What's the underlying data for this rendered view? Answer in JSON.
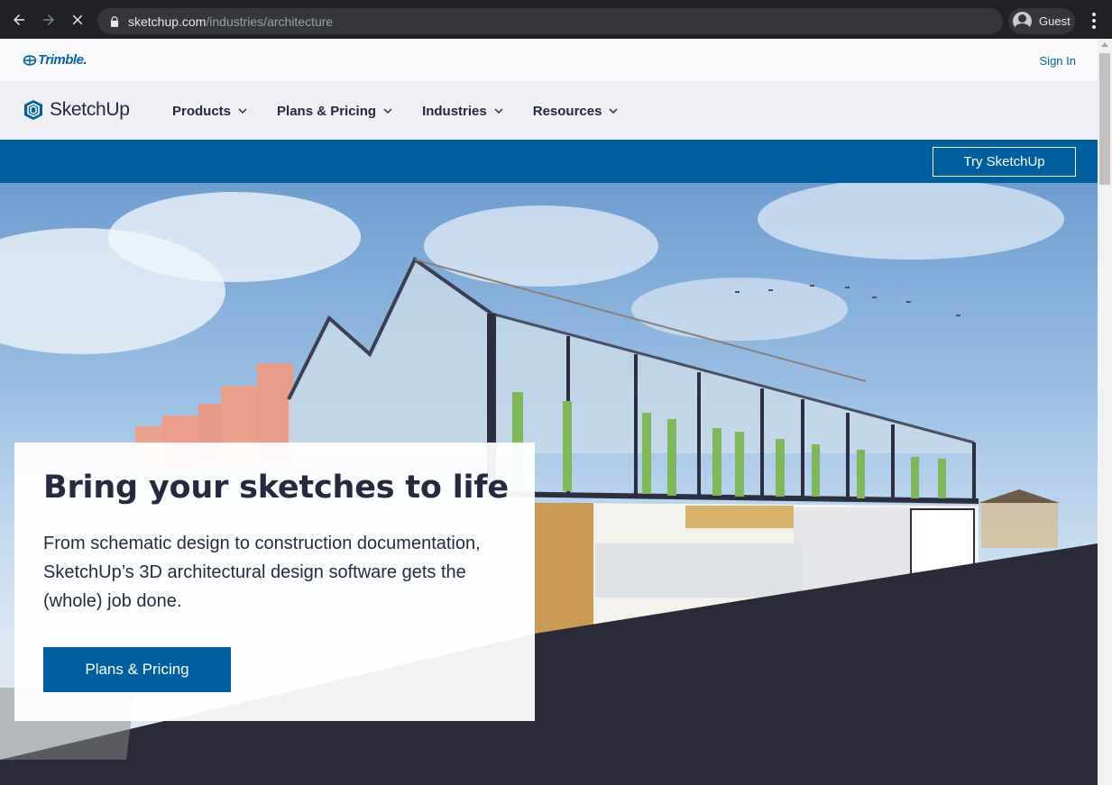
{
  "browser": {
    "url_host": "sketchup.com",
    "url_path": "/industries/architecture",
    "profile_name": "Guest",
    "icons": [
      "back-arrow-icon",
      "forward-arrow-icon",
      "stop-loading-icon",
      "lock-icon",
      "profile-icon",
      "kebab-menu-icon"
    ]
  },
  "topbar": {
    "brand": "Trimble.",
    "sign_in": "Sign In"
  },
  "nav": {
    "logo_text": "SketchUp",
    "items": [
      {
        "label": "Products"
      },
      {
        "label": "Plans & Pricing"
      },
      {
        "label": "Industries"
      },
      {
        "label": "Resources"
      }
    ]
  },
  "cta_bar": {
    "try_label": "Try SketchUp"
  },
  "hero": {
    "title": "Bring your sketches to life",
    "body": "From schematic design to construction documentation, SketchUp’s 3D architectural design software gets the (whole) job done.",
    "button_label": "Plans & Pricing"
  },
  "colors": {
    "brand_blue": "#005f9e",
    "text_dark": "#252a3f",
    "chrome_bg": "#202124"
  }
}
